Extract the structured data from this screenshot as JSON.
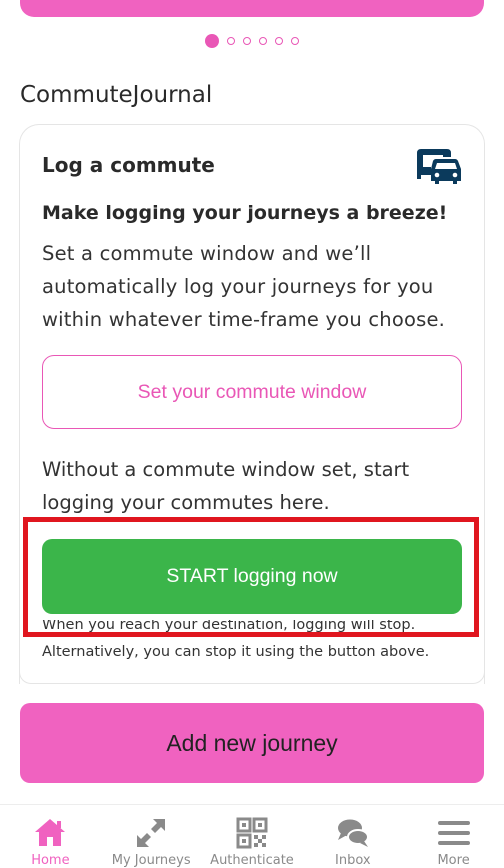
{
  "carousel": {
    "count": 6,
    "active": 0
  },
  "section": {
    "title": "CommuteJournal"
  },
  "card": {
    "heading": "Log a commute",
    "subheading": "Make logging your journeys a breeze!",
    "description": "Set a commute window and we’ll automatically log your journeys for you within whatever time-frame you choose.",
    "window_button_label": "Set your commute window",
    "manual_text": "Without a commute window set, start logging your commutes here.",
    "start_button_label": "START logging now",
    "note_line1": "When you reach your destination, logging will stop.",
    "note_line2": "Alternatively, you can stop it using the button above."
  },
  "add_button_label": "Add new journey",
  "colors": {
    "accent": "#f062c0",
    "green": "#3bb54a",
    "highlight": "#e0161f"
  },
  "nav": {
    "items": [
      {
        "label": "Home",
        "icon": "home-icon",
        "active": true
      },
      {
        "label": "My Journeys",
        "icon": "expand-arrows-icon",
        "active": false
      },
      {
        "label": "Authenticate",
        "icon": "qr-code-icon",
        "active": false
      },
      {
        "label": "Inbox",
        "icon": "chat-bubbles-icon",
        "active": false
      },
      {
        "label": "More",
        "icon": "menu-icon",
        "active": false
      }
    ]
  }
}
